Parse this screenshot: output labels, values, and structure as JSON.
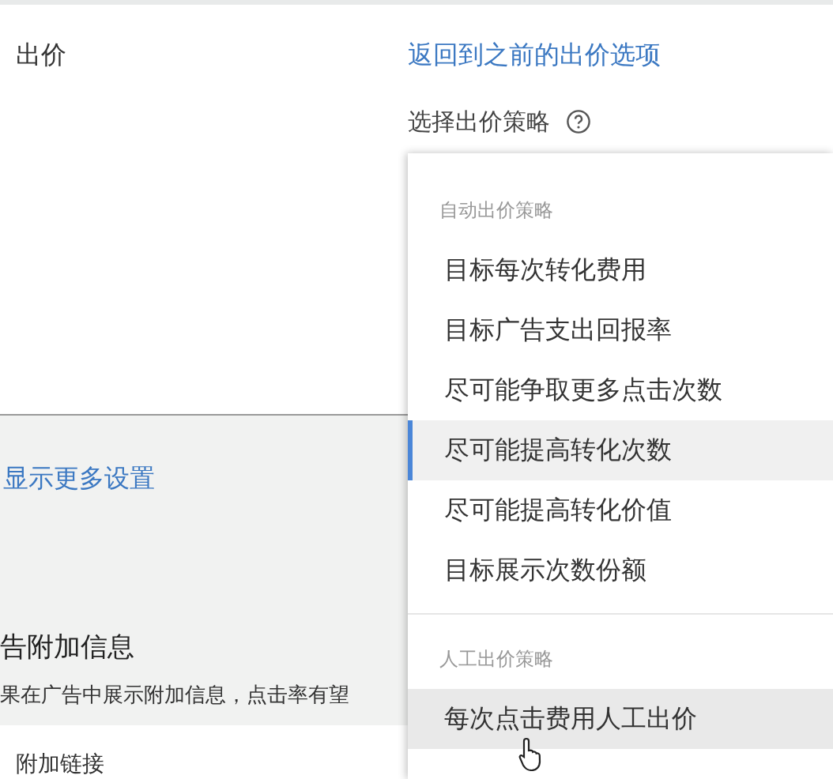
{
  "bidding": {
    "label": "出价",
    "back_link": "返回到之前的出价选项",
    "strategy_label": "选择出价策略"
  },
  "more_settings_link": "显示更多设置",
  "extensions": {
    "title": "告附加信息",
    "description": "果在广告中展示附加信息，点击率有望",
    "card_label": "附加链接"
  },
  "menu": {
    "groups": [
      {
        "header": "自动出价策略",
        "items": [
          {
            "label": "目标每次转化费用",
            "selected": false,
            "hovered": false
          },
          {
            "label": "目标广告支出回报率",
            "selected": false,
            "hovered": false
          },
          {
            "label": "尽可能争取更多点击次数",
            "selected": false,
            "hovered": false
          },
          {
            "label": "尽可能提高转化次数",
            "selected": true,
            "hovered": false
          },
          {
            "label": "尽可能提高转化价值",
            "selected": false,
            "hovered": false
          },
          {
            "label": "目标展示次数份额",
            "selected": false,
            "hovered": false
          }
        ]
      },
      {
        "header": "人工出价策略",
        "items": [
          {
            "label": "每次点击费用人工出价",
            "selected": false,
            "hovered": true
          }
        ]
      }
    ]
  }
}
